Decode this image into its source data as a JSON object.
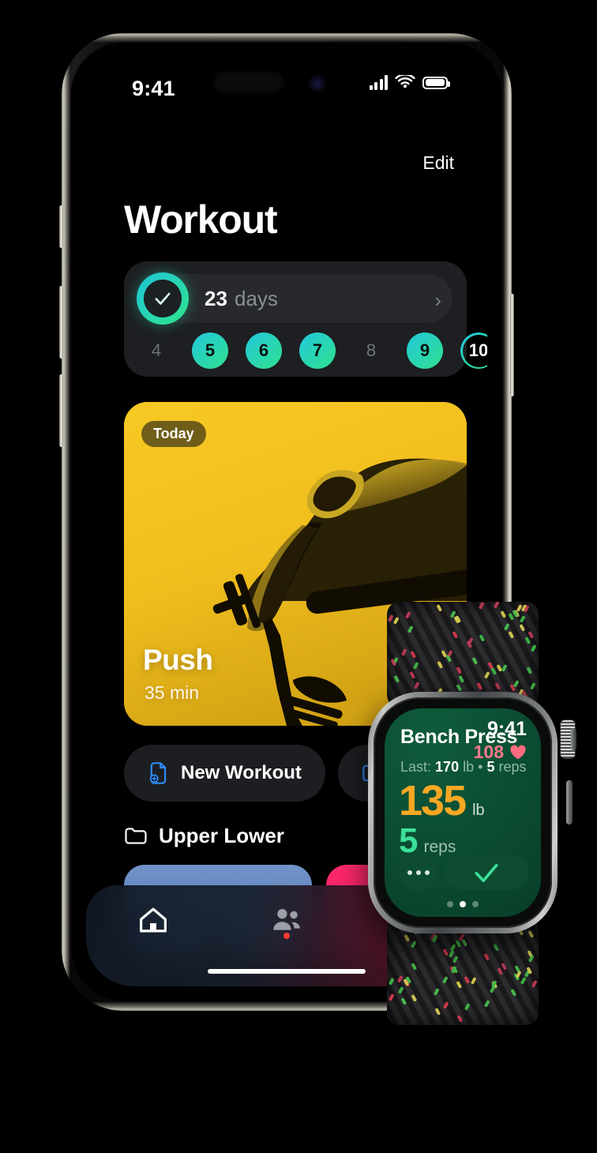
{
  "phone": {
    "status_bar": {
      "time": "9:41",
      "signal_icon": "cellular-signal-icon",
      "wifi_icon": "wifi-icon",
      "battery_icon": "battery-icon"
    },
    "nav": {
      "edit_label": "Edit",
      "title": "Workout"
    },
    "streak_card": {
      "check_icon": "checkmark-circle-icon",
      "count": "23",
      "unit": "days",
      "chevron": "›",
      "days": [
        {
          "label": "4",
          "state": "inactive"
        },
        {
          "label": "5",
          "state": "completed"
        },
        {
          "label": "6",
          "state": "completed"
        },
        {
          "label": "7",
          "state": "completed"
        },
        {
          "label": "8",
          "state": "inactive"
        },
        {
          "label": "9",
          "state": "completed"
        },
        {
          "label": "10",
          "state": "today"
        }
      ],
      "accent_from": "#23c8dc",
      "accent_to": "#2fe08d"
    },
    "hero_card": {
      "badge": "Today",
      "title": "Push",
      "subtitle": "35 min",
      "background_color": "#f5c421",
      "image_alt": "bench-press-photo"
    },
    "actions": [
      {
        "label": "New Workout",
        "icon": "new-document-plus-icon"
      },
      {
        "label": "",
        "icon": "new-folder-plus-icon"
      }
    ],
    "folder": {
      "icon": "folder-icon",
      "label": "Upper Lower",
      "cards": [
        {
          "name": "blue-workout-card",
          "color": "#5b7fb8"
        },
        {
          "name": "pink-workout-card",
          "color": "#ff2a6d"
        }
      ]
    },
    "tabs": [
      {
        "name": "home",
        "icon": "home-icon",
        "active": true,
        "badge": false
      },
      {
        "name": "community",
        "icon": "people-icon",
        "active": false,
        "badge": true
      },
      {
        "name": "stats",
        "icon": "bar-chart-icon",
        "active": false,
        "badge": false
      }
    ]
  },
  "watch": {
    "exercise": "Bench Press",
    "time": "9:41",
    "heart_rate": "108",
    "heart_icon": "heart-icon",
    "last_prefix": "Last:",
    "last_weight": "170",
    "last_weight_unit": "lb",
    "separator": "•",
    "last_reps": "5",
    "last_reps_unit": "reps",
    "weight_value": "135",
    "weight_unit": "lb",
    "reps_value": "5",
    "reps_unit": "reps",
    "more_icon": "ellipsis-icon",
    "done_icon": "checkmark-icon",
    "page_dots": 3,
    "page_active": 2,
    "weight_color": "#f7a723",
    "reps_color": "#3de09a",
    "screen_color": "#0b4e33"
  }
}
